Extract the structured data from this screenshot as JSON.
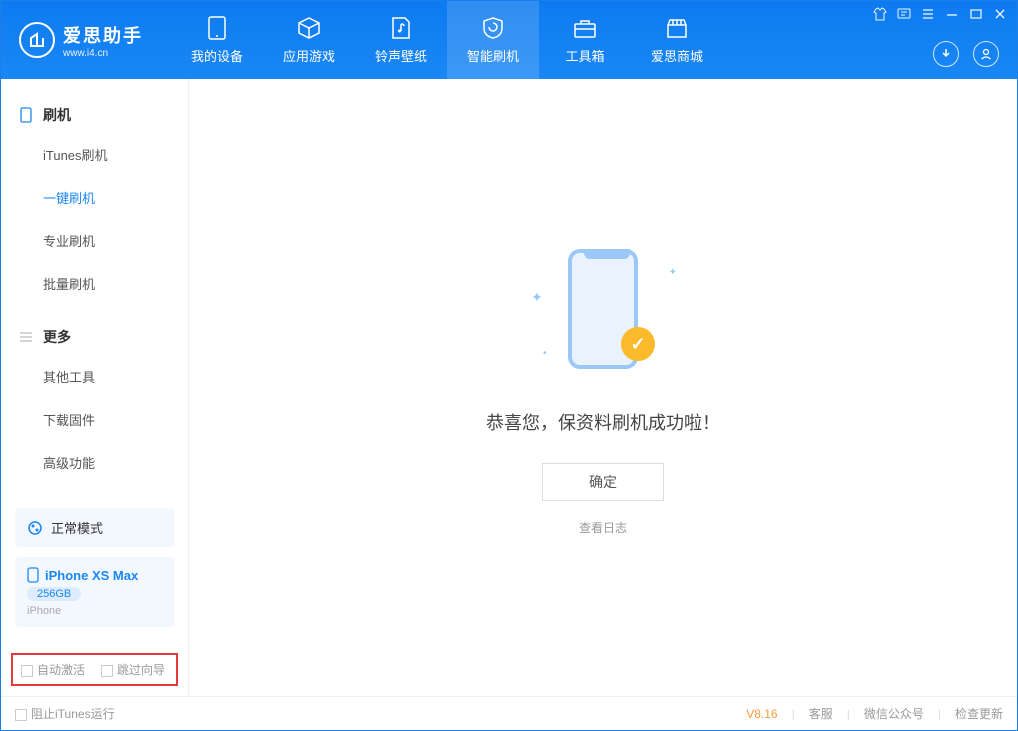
{
  "app": {
    "name_cn": "爱思助手",
    "name_en": "www.i4.cn"
  },
  "tabs": [
    {
      "label": "我的设备"
    },
    {
      "label": "应用游戏"
    },
    {
      "label": "铃声壁纸"
    },
    {
      "label": "智能刷机"
    },
    {
      "label": "工具箱"
    },
    {
      "label": "爱思商城"
    }
  ],
  "sidebar": {
    "group1": "刷机",
    "items1": [
      {
        "label": "iTunes刷机"
      },
      {
        "label": "一键刷机"
      },
      {
        "label": "专业刷机"
      },
      {
        "label": "批量刷机"
      }
    ],
    "group2": "更多",
    "items2": [
      {
        "label": "其他工具"
      },
      {
        "label": "下载固件"
      },
      {
        "label": "高级功能"
      }
    ],
    "mode": "正常模式",
    "device": {
      "name": "iPhone XS Max",
      "storage": "256GB",
      "type": "iPhone"
    },
    "auto_activate": "自动激活",
    "skip_guide": "跳过向导"
  },
  "main": {
    "result_text": "恭喜您，保资料刷机成功啦！",
    "ok": "确定",
    "view_log": "查看日志"
  },
  "status": {
    "block_itunes": "阻止iTunes运行",
    "version": "V8.16",
    "support": "客服",
    "wechat": "微信公众号",
    "update": "检查更新"
  }
}
